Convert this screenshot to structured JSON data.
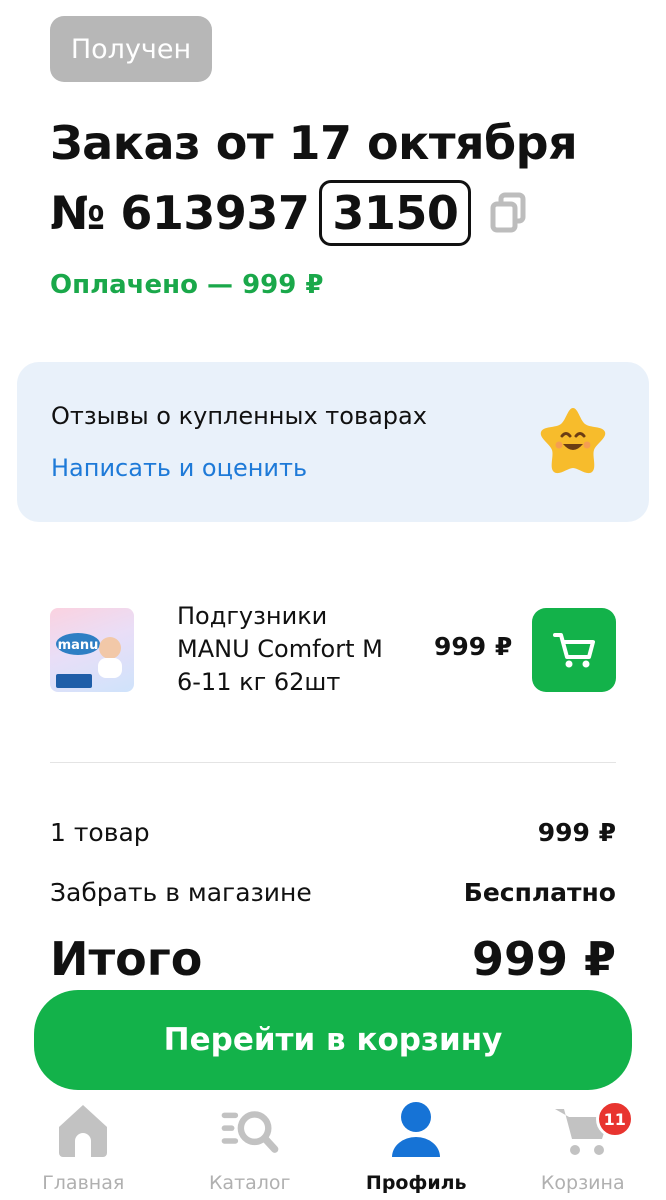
{
  "order": {
    "status": "Получен",
    "title": "Заказ от 17 октября",
    "number_prefix": "№ 613937",
    "number_suffix": "3150",
    "paid": "Оплачено — 999 ₽"
  },
  "reviews": {
    "title": "Отзывы о купленных товарах",
    "link": "Написать и оценить"
  },
  "product": {
    "name_line1": "Подгузники",
    "name_line2": "MANU Comfort M",
    "name_line3": "6-11 кг 62шт",
    "price": "999 ₽"
  },
  "summary": {
    "items_label": "1 товар",
    "items_value": "999 ₽",
    "pickup_label": "Забрать в магазине",
    "pickup_value": "Бесплатно",
    "total_label": "Итого",
    "total_value": "999 ₽"
  },
  "go_cart_button": "Перейти в корзину",
  "nav": {
    "home": "Главная",
    "catalog": "Каталог",
    "profile": "Профиль",
    "cart": "Корзина",
    "cart_badge": "11"
  },
  "colors": {
    "accent_green": "#13b24a",
    "paid_green": "#1aa84a",
    "link_blue": "#1e7ad8",
    "badge_red": "#e8342f",
    "active_nav_blue": "#1673d6"
  }
}
